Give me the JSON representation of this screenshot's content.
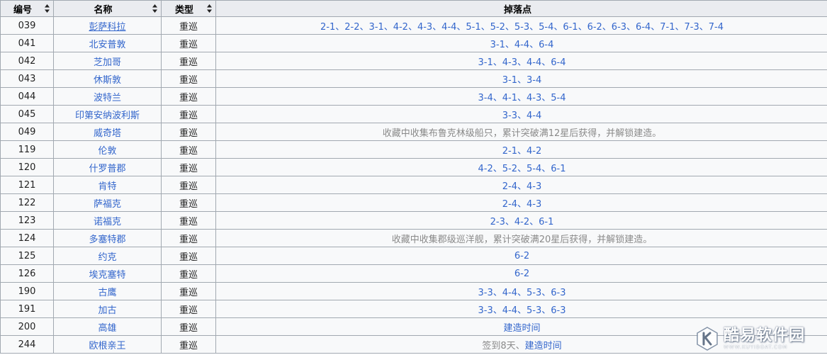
{
  "table": {
    "headers": [
      "编号",
      "名称",
      "类型",
      "掉落点"
    ],
    "rows": [
      {
        "id": "039",
        "name": "彭萨科拉",
        "type": "重巡",
        "drop": "2-1、2-2、3-1、4-2、4-3、4-4、5-1、5-2、5-3、5-4、6-1、6-2、6-3、6-4、7-1、7-3、7-4",
        "drop_style": "link"
      },
      {
        "id": "041",
        "name": "北安普敦",
        "type": "重巡",
        "drop": "3-1、4-4、6-4",
        "drop_style": "link"
      },
      {
        "id": "042",
        "name": "芝加哥",
        "type": "重巡",
        "drop": "3-1、4-3、4-4、6-4",
        "drop_style": "link"
      },
      {
        "id": "043",
        "name": "休斯敦",
        "type": "重巡",
        "drop": "3-1、3-4",
        "drop_style": "link"
      },
      {
        "id": "044",
        "name": "波特兰",
        "type": "重巡",
        "drop": "3-4、4-1、4-3、5-4",
        "drop_style": "link"
      },
      {
        "id": "045",
        "name": "印第安纳波利斯",
        "type": "重巡",
        "drop": "3-3、4-4",
        "drop_style": "link"
      },
      {
        "id": "049",
        "name": "威奇塔",
        "type": "重巡",
        "drop": "收藏中收集布鲁克林级船只，累计突破满12星后获得，并解锁建造。",
        "drop_style": "muted"
      },
      {
        "id": "119",
        "name": "伦敦",
        "type": "重巡",
        "drop": "2-1、4-2",
        "drop_style": "link"
      },
      {
        "id": "120",
        "name": "什罗普郡",
        "type": "重巡",
        "drop": "4-2、5-2、5-4、6-1",
        "drop_style": "link"
      },
      {
        "id": "121",
        "name": "肯特",
        "type": "重巡",
        "drop": "2-4、4-3",
        "drop_style": "link"
      },
      {
        "id": "122",
        "name": "萨福克",
        "type": "重巡",
        "drop": "2-4、4-3",
        "drop_style": "link"
      },
      {
        "id": "123",
        "name": "诺福克",
        "type": "重巡",
        "drop": "2-3、4-2、6-1",
        "drop_style": "link"
      },
      {
        "id": "124",
        "name": "多塞特郡",
        "type": "重巡",
        "drop": "收藏中收集郡级巡洋舰，累计突破满20星后获得，并解锁建造。",
        "drop_style": "muted"
      },
      {
        "id": "125",
        "name": "约克",
        "type": "重巡",
        "drop": "6-2",
        "drop_style": "link"
      },
      {
        "id": "126",
        "name": "埃克塞特",
        "type": "重巡",
        "drop": "6-2",
        "drop_style": "link"
      },
      {
        "id": "190",
        "name": "古鹰",
        "type": "重巡",
        "drop": "3-3、4-4、5-3、6-3",
        "drop_style": "link"
      },
      {
        "id": "191",
        "name": "加古",
        "type": "重巡",
        "drop": "3-3、4-4、5-3、6-3",
        "drop_style": "link"
      },
      {
        "id": "200",
        "name": "高雄",
        "type": "重巡",
        "drop": "建造时间",
        "drop_style": "link"
      },
      {
        "id": "244",
        "name": "欧根亲王",
        "type": "重巡",
        "drop_prefix": "签到8天、",
        "drop": "建造时间",
        "drop_style": "mixed"
      }
    ]
  },
  "watermark": {
    "cn": "酷易软件园",
    "en": "WWW.KUYIBOAT.COM"
  },
  "colors": {
    "link": "#3366cc",
    "muted": "#8a8a8a",
    "header_bg": "#eaecf0",
    "cell_bg": "#f8f9fa",
    "border": "#a2a9b1"
  }
}
